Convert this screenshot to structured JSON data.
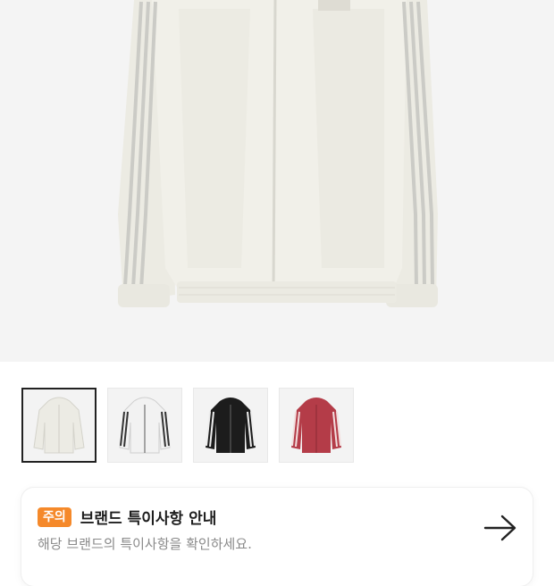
{
  "product": {
    "main_image": "white-windbreaker-jacket",
    "thumbnails": [
      {
        "label": "white-hooded-jacket",
        "selected": true,
        "color": "#ecebe4"
      },
      {
        "label": "white-black-hooded-jacket",
        "selected": false,
        "color": "#f2f2f2"
      },
      {
        "label": "black-hooded-jacket",
        "selected": false,
        "color": "#1c1c1c"
      },
      {
        "label": "red-hooded-jacket",
        "selected": false,
        "color": "#b43c48"
      }
    ]
  },
  "notice": {
    "badge": "주의",
    "title": "브랜드 특이사항 안내",
    "subtitle": "해당 브랜드의 특이사항을 확인하세요.",
    "arrow_icon": "arrow-right-icon",
    "badge_color": "#f5892a"
  }
}
